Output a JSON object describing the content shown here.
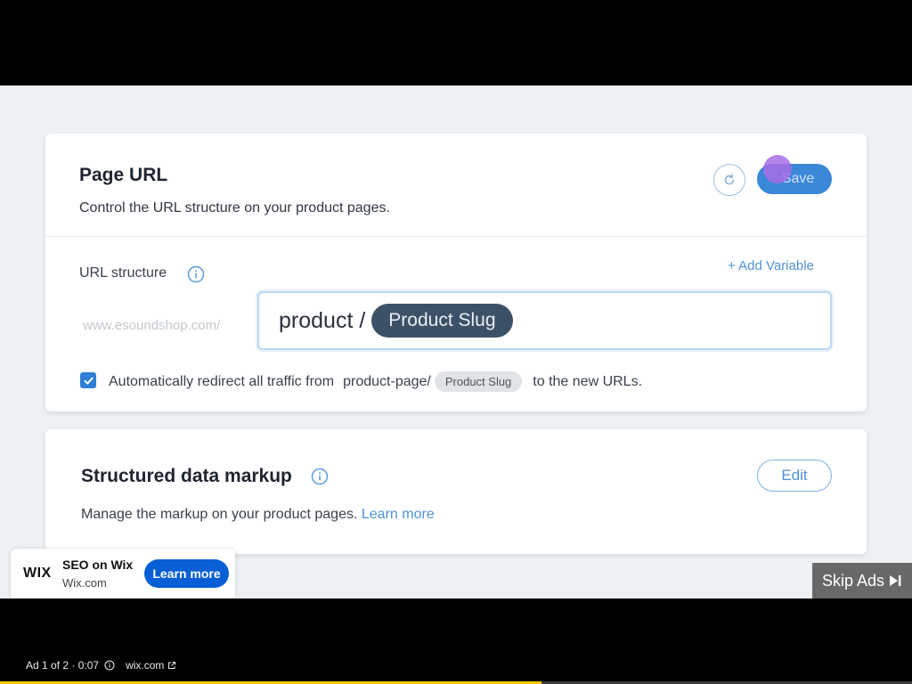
{
  "page_url_card": {
    "title": "Page URL",
    "subtitle": "Control the URL structure on your product pages.",
    "save_label": "Save",
    "url_structure_label": "URL structure",
    "add_variable_label": "+ Add Variable",
    "domain_placeholder": "www.esoundshop.com/",
    "url_prefix": "product /",
    "url_slug_variable": "Product Slug",
    "redirect_checked": true,
    "redirect_text_before": "Automatically redirect all traffic from",
    "redirect_old_prefix": "product-page/",
    "redirect_slug_chip": "Product Slug",
    "redirect_text_after": "to the new URLs."
  },
  "structured_data_card": {
    "title": "Structured data markup",
    "edit_label": "Edit",
    "description": "Manage the markup on your product pages.",
    "learn_more_label": "Learn more"
  },
  "ad": {
    "logo_text": "WIX",
    "title": "SEO on Wix",
    "url": "Wix.com",
    "cta_label": "Learn more",
    "skip_label": "Skip Ads",
    "status_text": "Ad 1 of 2 · 0:07",
    "site_link": "wix.com",
    "progress_fraction": 0.594
  },
  "colors": {
    "accent_blue": "#3b87d8",
    "link_blue": "#4f92d6",
    "slug_pill": "#3c5166",
    "cta_blue": "#065fd4",
    "progress_yellow": "#f2c400"
  }
}
